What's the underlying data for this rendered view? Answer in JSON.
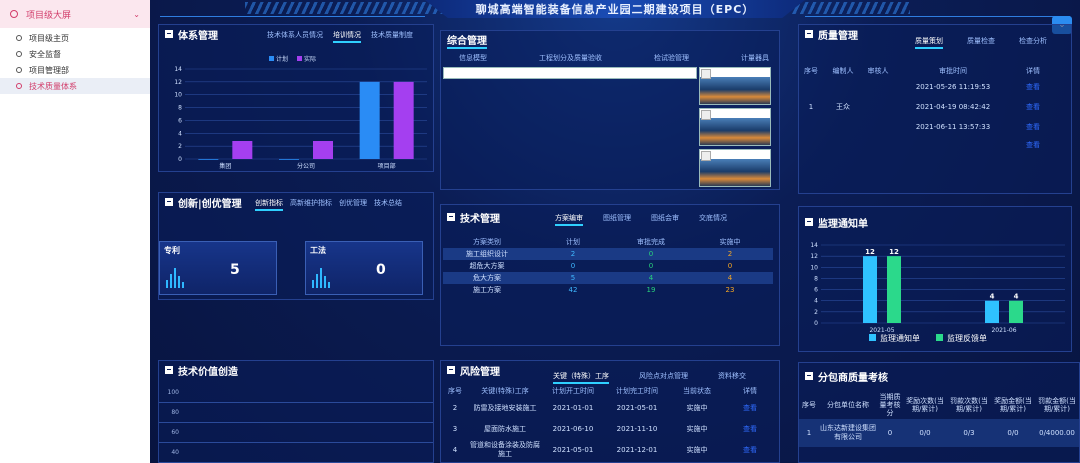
{
  "sidebar": {
    "header": "项目级大屏",
    "items": [
      {
        "label": "项目级主页"
      },
      {
        "label": "安全监督"
      },
      {
        "label": "项目管理部"
      },
      {
        "label": "技术质量体系"
      }
    ]
  },
  "title": "聊城高端智能装备信息产业园二期建设项目（EPC）",
  "system": {
    "title": "体系管理",
    "tabs": [
      "技术体系人员情况",
      "培训情况",
      "技术质量制度"
    ],
    "legend": [
      "计划",
      "实际"
    ],
    "yticks": [
      "14",
      "12",
      "10",
      "8",
      "6",
      "4",
      "2",
      "0"
    ],
    "chart_data": {
      "type": "bar",
      "categories": [
        "集团",
        "分公司",
        "项目部"
      ],
      "series": [
        {
          "name": "计划",
          "values": [
            0,
            0,
            12
          ],
          "color": "#2a8cf5"
        },
        {
          "name": "实际",
          "values": [
            2.8,
            2.8,
            12
          ],
          "color": "#a43ff0"
        }
      ],
      "ylim": [
        0,
        14
      ]
    }
  },
  "integrated": {
    "title": "综合管理",
    "tabs": [
      "信息模型",
      "工程划分及质量验收",
      "检试验管理",
      "计量器具"
    ]
  },
  "quality": {
    "title": "质量管理",
    "tabs": [
      "质量策划",
      "质量检查",
      "检查分析"
    ],
    "headers": [
      "序号",
      "编制人",
      "审核人",
      "审批时间",
      "详情"
    ],
    "rows": [
      {
        "no": "",
        "author": "",
        "reviewer": "",
        "time": "2021-05-26 11:19:53",
        "detail": "查看"
      },
      {
        "no": "1",
        "author": "王众",
        "reviewer": "",
        "time": "2021-04-19 08:42:42",
        "detail": "查看"
      },
      {
        "no": "",
        "author": "",
        "reviewer": "",
        "time": "2021-06-11 13:57:33",
        "detail": "查看"
      },
      {
        "no": "",
        "author": "",
        "reviewer": "",
        "time": "",
        "detail": "查看"
      }
    ]
  },
  "innovation": {
    "title": "创新|创优管理",
    "tabs": [
      "创新指标",
      "高新维护指标",
      "创优管理",
      "技术总结"
    ],
    "kpis": [
      {
        "label": "专利",
        "value": "5"
      },
      {
        "label": "工法",
        "value": "0"
      }
    ]
  },
  "tech": {
    "title": "技术管理",
    "tabs": [
      "方案编审",
      "图纸管理",
      "图纸会审",
      "交底情况"
    ],
    "headers": [
      "方案类别",
      "计划",
      "审批完成",
      "实施中"
    ],
    "rows": [
      {
        "cat": "施工组织设计",
        "plan": "2",
        "done": "0",
        "doing": "2"
      },
      {
        "cat": "超危大方案",
        "plan": "0",
        "done": "0",
        "doing": "0"
      },
      {
        "cat": "危大方案",
        "plan": "5",
        "done": "4",
        "doing": "4"
      },
      {
        "cat": "施工方案",
        "plan": "42",
        "done": "19",
        "doing": "23"
      }
    ]
  },
  "supervision": {
    "title": "监理通知单",
    "yticks": [
      "14",
      "12",
      "10",
      "8",
      "6",
      "4",
      "2",
      "0"
    ],
    "legend": [
      "监理通知单",
      "监理反馈单"
    ],
    "chart_data": {
      "type": "bar",
      "categories": [
        "2021-05",
        "2021-06"
      ],
      "series": [
        {
          "name": "监理通知单",
          "values": [
            12,
            4
          ],
          "color": "#2fc2ff"
        },
        {
          "name": "监理反馈单",
          "values": [
            12,
            4
          ],
          "color": "#2bd98b"
        }
      ],
      "ylim": [
        0,
        14
      ]
    }
  },
  "value": {
    "title": "技术价值创造",
    "yticks": [
      "100",
      "80",
      "60",
      "40"
    ]
  },
  "risk": {
    "title": "风险管理",
    "tabs": [
      "关键（特殊）工序",
      "风险点对点管理",
      "资料移交"
    ],
    "headers": [
      "序号",
      "关键(特殊)工序",
      "计划开工时间",
      "计划完工时间",
      "当前状态",
      "详情"
    ],
    "rows": [
      {
        "no": "2",
        "name": "防雷及接地安装施工",
        "start": "2021-01-01",
        "end": "2021-05-01",
        "status": "实施中",
        "detail": "查看"
      },
      {
        "no": "3",
        "name": "屋面防水施工",
        "start": "2021-06-10",
        "end": "2021-11-10",
        "status": "实施中",
        "detail": "查看"
      },
      {
        "no": "4",
        "name": "管道和设备涂装及防腐施工",
        "start": "2021-05-01",
        "end": "2021-12-01",
        "status": "实施中",
        "detail": "查看"
      }
    ]
  },
  "subcontract": {
    "title": "分包商质量考核",
    "headers": [
      "序号",
      "分包单位名称",
      "当期质量考核分",
      "奖励次数(当期/累计)",
      "罚款次数(当期/累计)",
      "奖励金额(当期/累计)",
      "罚款金额(当期/累计)"
    ],
    "rows": [
      {
        "no": "1",
        "name": "山东达新建设集团有限公司",
        "score": "0",
        "reward": "0/0",
        "fine": "0/3",
        "reward_amt": "0/0",
        "fine_amt": "0/4000.00"
      }
    ]
  }
}
